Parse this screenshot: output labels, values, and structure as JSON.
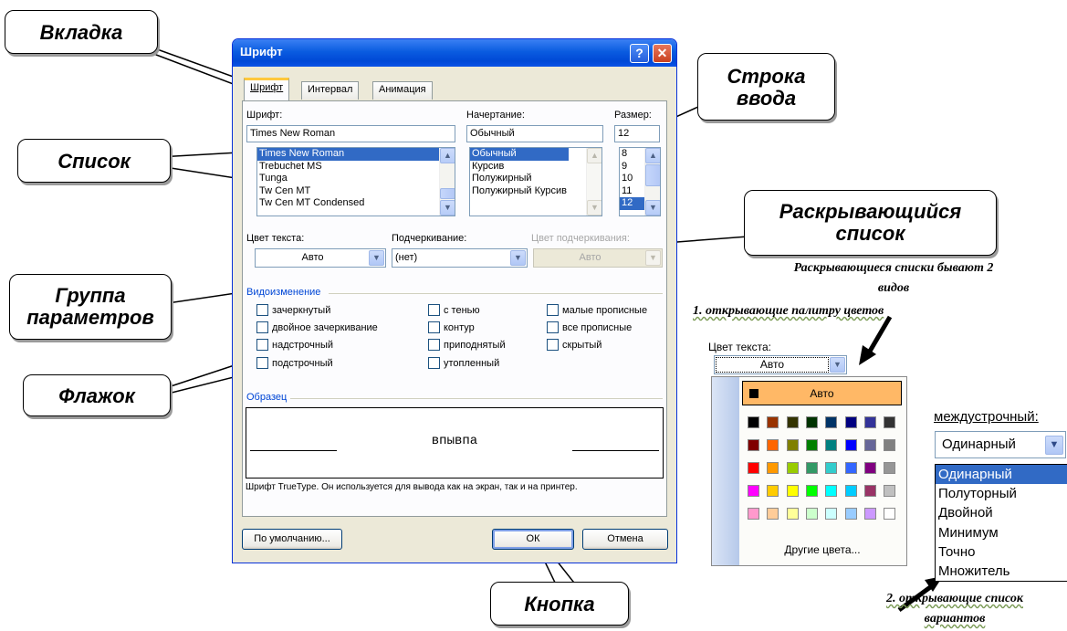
{
  "dialog": {
    "title": "Шрифт",
    "tabs": [
      "Шрифт",
      "Интервал",
      "Анимация"
    ],
    "font_label": "Шрифт:",
    "font_value": "Times New Roman",
    "font_list": [
      "Times New Roman",
      "Trebuchet MS",
      "Tunga",
      "Tw Cen MT",
      "Tw Cen MT Condensed"
    ],
    "style_label": "Начертание:",
    "style_value": "Обычный",
    "style_list": [
      "Обычный",
      "Курсив",
      "Полужирный",
      "Полужирный Курсив"
    ],
    "size_label": "Размер:",
    "size_value": "12",
    "size_list": [
      "8",
      "9",
      "10",
      "11",
      "12"
    ],
    "color_label": "Цвет текста:",
    "color_value": "Авто",
    "underline_label": "Подчеркивание:",
    "underline_value": "(нет)",
    "underline_color_label": "Цвет подчеркивания:",
    "underline_color_value": "Авто",
    "effects_title": "Видоизменение",
    "effects": [
      [
        "зачеркнутый",
        "двойное зачеркивание",
        "надстрочный",
        "подстрочный"
      ],
      [
        "с тенью",
        "контур",
        "приподнятый",
        "утопленный"
      ],
      [
        "малые прописные",
        "все прописные",
        "скрытый"
      ]
    ],
    "preview_title": "Образец",
    "preview_text": "впывпа",
    "truetype_note": "Шрифт TrueType. Он используется для вывода как на экран, так и на принтер.",
    "btn_default": "По умолчанию...",
    "btn_ok": "ОК",
    "btn_cancel": "Отмена"
  },
  "callouts": {
    "vkladka": "Вкладка",
    "stroka_1": "Строка",
    "stroka_2": "ввода",
    "spisok": "Список",
    "raskr_1": "Раскрывающийся",
    "raskr_2": "список",
    "gruppa_1": "Группа",
    "gruppa_2": "параметров",
    "flazhok": "Флажок",
    "knopka": "Кнопка"
  },
  "notes": {
    "types_line1": "Раскрывающиеся списки бывают 2",
    "types_line2": "видов",
    "type1": "1. открывающие палитру цветов",
    "type2_line1": "2. открывающие список",
    "type2_line2": "вариантов"
  },
  "color_example": {
    "label": "Цвет текста:",
    "value": "Авто",
    "auto_label": "Авто",
    "more_colors": "Другие цвета...",
    "swatches": [
      [
        "#000000",
        "#993300",
        "#333300",
        "#003300",
        "#003366",
        "#000080",
        "#333399",
        "#333333"
      ],
      [
        "#800000",
        "#ff6600",
        "#808000",
        "#008000",
        "#008080",
        "#0000ff",
        "#666699",
        "#808080"
      ],
      [
        "#ff0000",
        "#ff9900",
        "#99cc00",
        "#339966",
        "#33cccc",
        "#3366ff",
        "#800080",
        "#969696"
      ],
      [
        "#ff00ff",
        "#ffcc00",
        "#ffff00",
        "#00ff00",
        "#00ffff",
        "#00ccff",
        "#993366",
        "#c0c0c0"
      ],
      [
        "#ff99cc",
        "#ffcc99",
        "#ffff99",
        "#ccffcc",
        "#ccffff",
        "#99ccff",
        "#cc99ff",
        "#ffffff"
      ]
    ]
  },
  "spacing_example": {
    "label": "междустрочный:",
    "value": "Одинарный",
    "options": [
      "Одинарный",
      "Полуторный",
      "Двойной",
      "Минимум",
      "Точно",
      "Множитель"
    ]
  }
}
